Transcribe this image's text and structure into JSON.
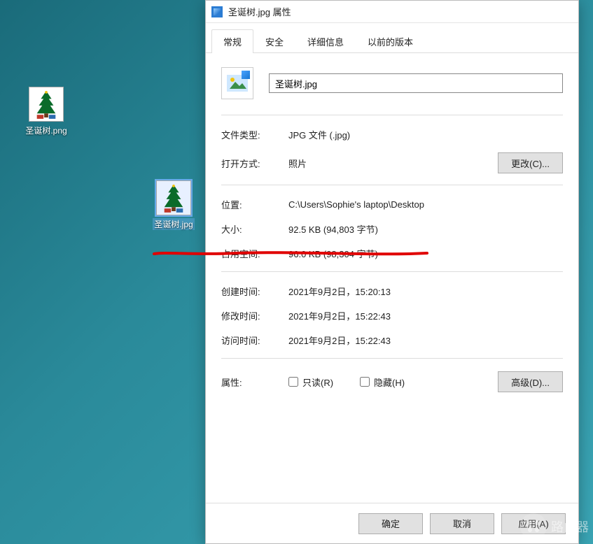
{
  "desktop": {
    "icons": [
      {
        "label": "圣诞树.png"
      },
      {
        "label": "圣诞树.jpg"
      }
    ]
  },
  "dialog": {
    "title": "圣诞树.jpg 属性",
    "tabs": [
      "常规",
      "安全",
      "详细信息",
      "以前的版本"
    ],
    "filename_value": "圣诞树.jpg",
    "props": {
      "file_type_label": "文件类型:",
      "file_type_value": "JPG 文件 (.jpg)",
      "open_with_label": "打开方式:",
      "open_with_value": "照片",
      "change_btn": "更改(C)...",
      "location_label": "位置:",
      "location_value": "C:\\Users\\Sophie's laptop\\Desktop",
      "size_label": "大小:",
      "size_value": "92.5 KB (94,803 字节)",
      "disk_label": "占用空间:",
      "disk_value": "96.0 KB (98,304 字节)",
      "created_label": "创建时间:",
      "created_value": "2021年9月2日，15:20:13",
      "modified_label": "修改时间:",
      "modified_value": "2021年9月2日，15:22:43",
      "accessed_label": "访问时间:",
      "accessed_value": "2021年9月2日，15:22:43",
      "attr_label": "属性:",
      "readonly_label": "只读(R)",
      "hidden_label": "隐藏(H)",
      "advanced_btn": "高级(D)..."
    },
    "buttons": {
      "ok": "确定",
      "cancel": "取消",
      "apply": "应用(A)"
    }
  },
  "watermark": {
    "text": "路由器"
  }
}
